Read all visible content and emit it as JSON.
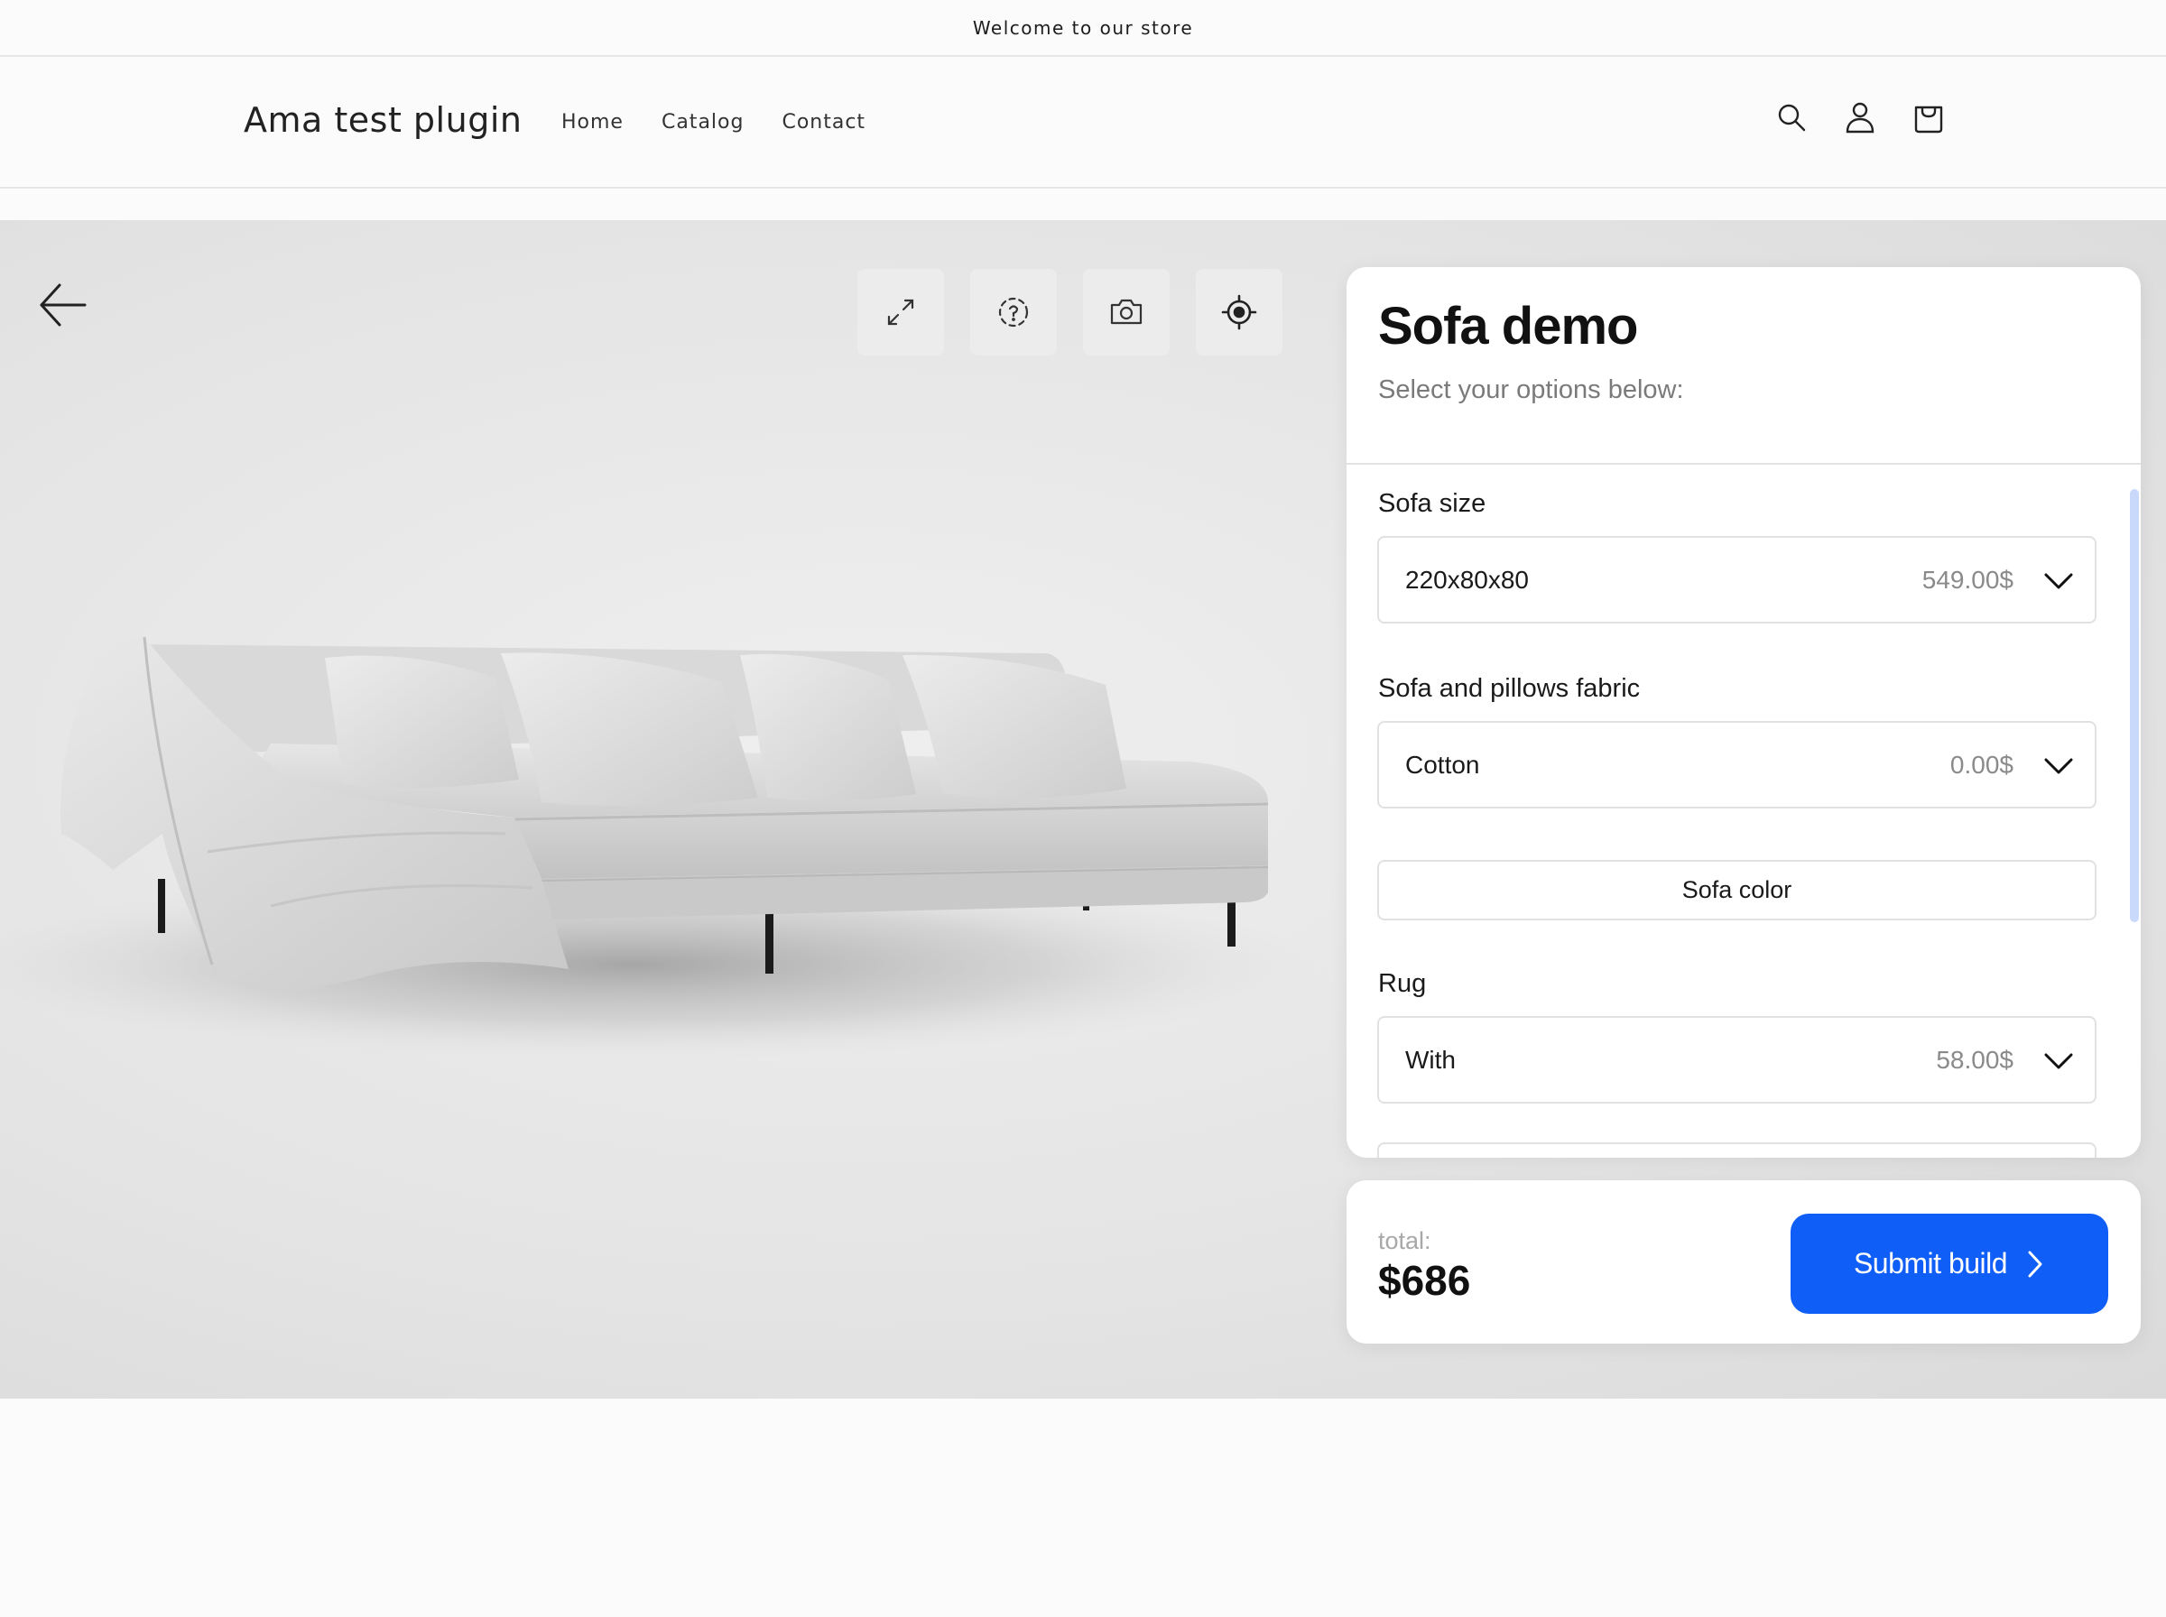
{
  "announcement": {
    "text": "Welcome to our store"
  },
  "header": {
    "logo": "Ama test plugin",
    "nav": [
      {
        "label": "Home"
      },
      {
        "label": "Catalog"
      },
      {
        "label": "Contact"
      }
    ],
    "icons": [
      "search-icon",
      "account-icon",
      "cart-icon"
    ]
  },
  "viewer": {
    "icons": [
      "back-arrow-icon",
      "fullscreen-icon",
      "rotate-360-icon",
      "camera-icon",
      "recenter-icon"
    ],
    "background": "#e4e4e4"
  },
  "configurator": {
    "title": "Sofa demo",
    "subtitle": "Select your options below:",
    "options": [
      {
        "label": "Sofa size",
        "value": "220x80x80",
        "price": "549.00$"
      },
      {
        "label": "Sofa and pillows fabric",
        "value": "Cotton",
        "price": "0.00$"
      },
      {
        "label": "Rug",
        "value": "With",
        "price": "58.00$"
      }
    ],
    "color_button": "Sofa color"
  },
  "summary": {
    "total_label": "total:",
    "total_value": "$686",
    "submit_label": "Submit build",
    "accent_color": "#0f5ef7"
  }
}
